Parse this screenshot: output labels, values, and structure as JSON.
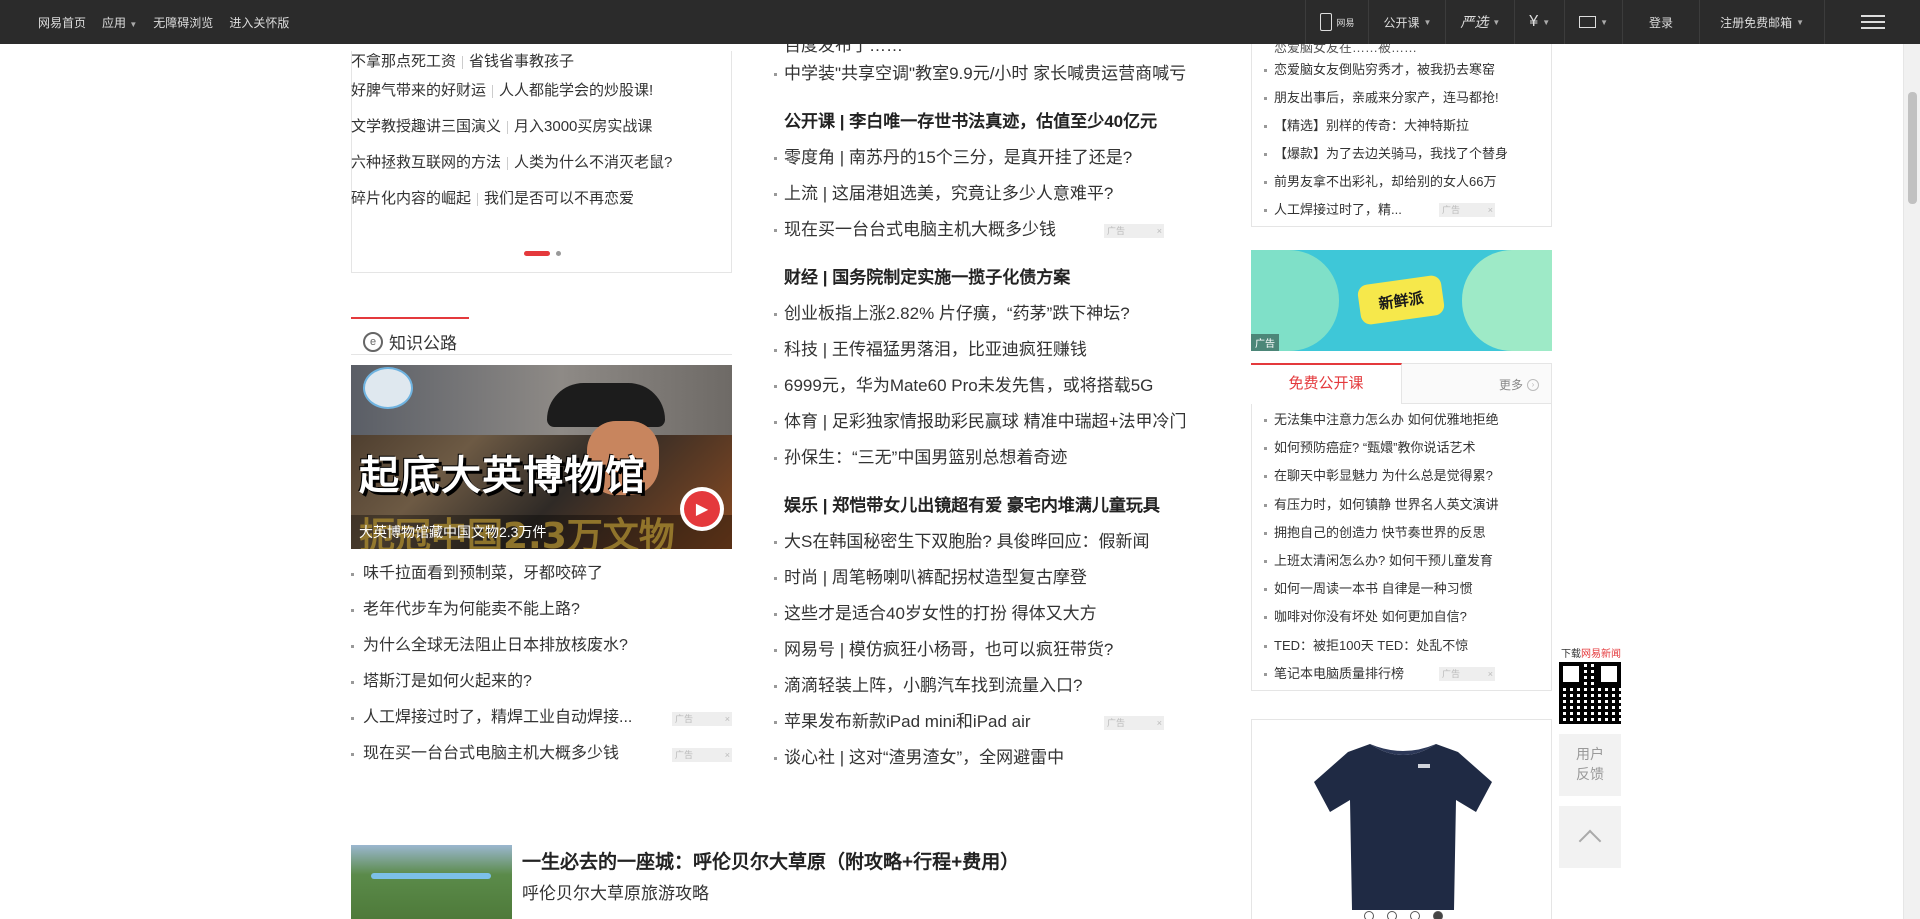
{
  "topbar": {
    "left": [
      "网易首页",
      "应用",
      "无障碍浏览",
      "进入关怀版"
    ],
    "right": {
      "phone": "网易",
      "course": "公开课",
      "yanxuan": "严选",
      "money": "¥",
      "login": "登录",
      "register": "注册免费邮箱"
    }
  },
  "left": {
    "pairs": [
      [
        "不拿那点死工资",
        "省钱省事教孩子"
      ],
      [
        "好脾气带来的好财运",
        "人人都能学会的炒股课!"
      ],
      [
        "文学教授趣讲三国演义",
        "月入3000买房实战课"
      ],
      [
        "六种拯救互联网的方法",
        "人类为什么不消灭老鼠?"
      ],
      [
        "碎片化内容的崛起",
        "我们是否可以不再恋爱"
      ]
    ],
    "section_title": "知识公路",
    "hero": {
      "big1": "起底大英博物馆",
      "big2": "扼冠中国2.3万文物",
      "caption": "大英博物馆藏中国文物2.3万件"
    },
    "items": [
      "味千拉面看到预制菜，牙都咬碎了",
      "老年代步车为何能卖不能上路?",
      "为什么全球无法阻止日本排放核废水?",
      "塔斯汀是如何火起来的?",
      "人工焊接过时了，精焊工业自动焊接...",
      "现在买一台台式电脑主机大概多少钱"
    ],
    "ad_label": "广告"
  },
  "middle": {
    "items": [
      {
        "t": "百度发布了……",
        "type": "clip"
      },
      {
        "t": "中学装\"共享空调\"教室9.9元/小时 家长喊贵运营商喊亏",
        "type": "item"
      },
      {
        "t": "公开课 | 李白唯一存世书法真迹，估值至少40亿元",
        "type": "head"
      },
      {
        "t": "零度角 | 南苏丹的15个三分，是真开挂了还是?",
        "type": "item"
      },
      {
        "t": "上流 | 这届港姐选美，究竟让多少人意难平?",
        "type": "item"
      },
      {
        "t": "现在买一台台式电脑主机大概多少钱",
        "type": "ad"
      },
      {
        "t": "财经 | 国务院制定实施一揽子化债方案",
        "type": "head"
      },
      {
        "t": "创业板指上涨2.82% 片仔癀，“药茅”跌下神坛?",
        "type": "item"
      },
      {
        "t": "科技 | 王传福猛男落泪，比亚迪疯狂赚钱",
        "type": "item"
      },
      {
        "t": "6999元，华为Mate60 Pro未发先售，或将搭载5G",
        "type": "item"
      },
      {
        "t": "体育 | 足彩独家情报助彩民赢球 精准中瑞超+法甲冷门",
        "type": "item"
      },
      {
        "t": "孙保生：“三无”中国男篮别总想着奇迹",
        "type": "item"
      },
      {
        "t": "娱乐 | 郑恺带女儿出镜超有爱 豪宅内堆满儿童玩具",
        "type": "head"
      },
      {
        "t": "大S在韩国秘密生下双胞胎? 具俊晔回应：假新闻",
        "type": "item"
      },
      {
        "t": "时尚 | 周笔畅喇叭裤配拐杖造型复古摩登",
        "type": "item"
      },
      {
        "t": "这些才是适合40岁女性的打扮 得体又大方",
        "type": "item"
      },
      {
        "t": "网易号 | 模仿疯狂小杨哥，也可以疯狂带货?",
        "type": "item"
      },
      {
        "t": "滴滴轻装上阵，小鹏汽车找到流量入口?",
        "type": "item"
      },
      {
        "t": "苹果发布新款iPad mini和iPad air",
        "type": "ad"
      },
      {
        "t": "谈心社 | 这对“渣男渣女”，全网避雷中",
        "type": "item"
      }
    ]
  },
  "feature": {
    "title": "一生必去的一座城：呼伦贝尔大草原（附攻略+行程+费用）",
    "subtitle": "呼伦贝尔大草原旅游攻略"
  },
  "right": {
    "top_list": [
      "恋爱脑女友在……被……",
      "恋爱脑女友倒贴穷秀才，被我扔去寒窑",
      "朋友出事后，亲戚来分家产，连马都抢!",
      "【精选】别样的传奇：大神特斯拉",
      "【爆款】为了去边关骑马，我找了个替身",
      "前男友拿不出彩礼，却给别的女人66万",
      "人工焊接过时了，精..."
    ],
    "banner_text": "新鲜派",
    "banner_ad": "广告",
    "course_tab": "免费公开课",
    "course_more": "更多",
    "course_list": [
      "无法集中注意力怎么办 如何优雅地拒绝",
      "如何预防癌症? “甄嬛”教你说话艺术",
      "在聊天中彰显魅力 为什么总是觉得累?",
      "有压力时，如何镇静 世界名人英文演讲",
      "拥抱自己的创造力 快节奏世界的反思",
      "上班太清闲怎么办? 如何干预儿童发育",
      "如何一周读一本书 自律是一种习惯",
      "咖啡对你没有坏处 如何更加自信?",
      "TED：被拒100天 TED：处乱不惊",
      "笔记本电脑质量排行榜"
    ]
  },
  "side": {
    "download_pre": "下载",
    "download_brand": "网易新闻",
    "feedback1": "用户",
    "feedback2": "反馈"
  }
}
